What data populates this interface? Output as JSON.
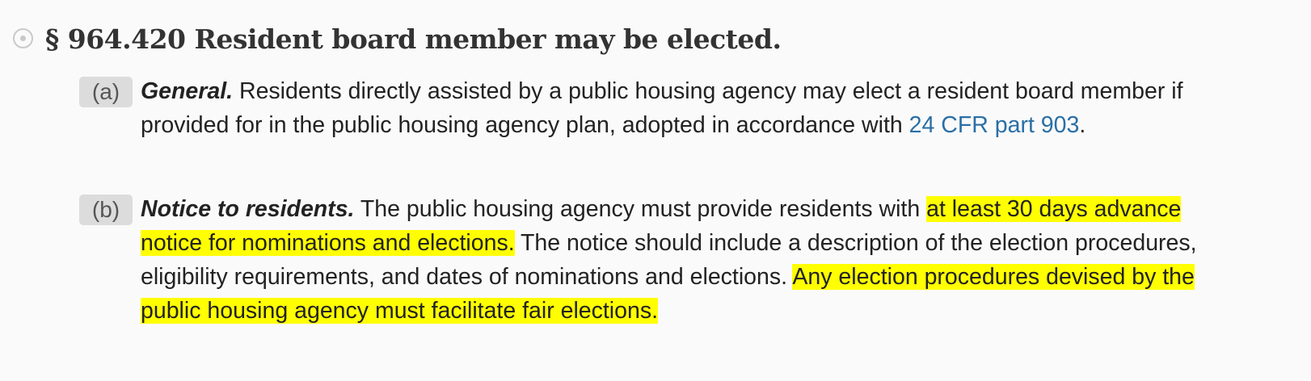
{
  "section": {
    "title": "§ 964.420 Resident board member may be elected.",
    "icon": "radio-target-icon"
  },
  "paragraphs": [
    {
      "marker": "(a)",
      "heading": "General.",
      "text_1": " Residents directly assisted by a public housing agency may elect a resident board member if provided for in the public housing agency plan, adopted in accordance with ",
      "link": "24 CFR part 903",
      "text_2": "."
    },
    {
      "marker": "(b)",
      "heading": "Notice to residents.",
      "text_1": " The public housing agency must provide residents with ",
      "highlight_1": "at least 30 days advance notice for nominations and elections.",
      "text_2": " The notice should include a description of the election procedures, eligibility requirements, and dates of nominations and elections. ",
      "highlight_2": "Any election procedures devised by the public housing agency must facilitate fair elections."
    }
  ],
  "colors": {
    "highlight": "#ffff00",
    "link": "#2a6fa6",
    "marker_bg": "#dcdcdc"
  }
}
